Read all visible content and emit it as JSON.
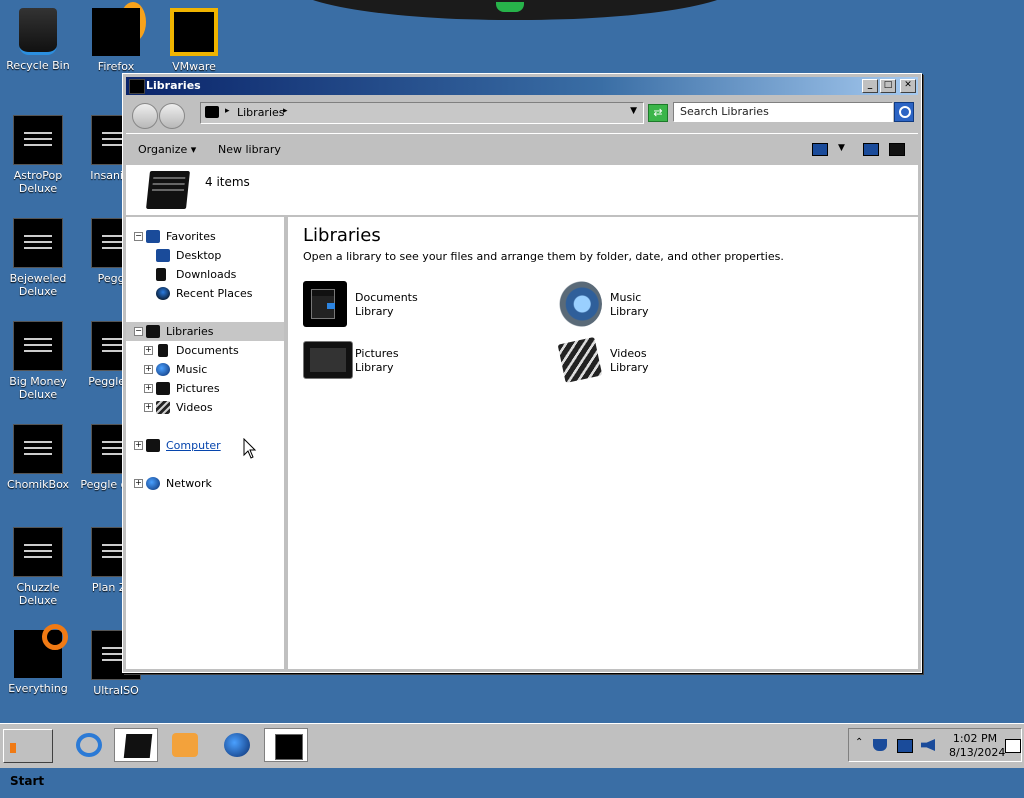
{
  "desktop": {
    "icons": [
      {
        "label": "Recycle Bin",
        "icon": "recycle-bin-icon"
      },
      {
        "label": "Firefox",
        "icon": "firefox-icon"
      },
      {
        "label": "VMware",
        "icon": "vmware-icon"
      },
      {
        "label": "AstroPop Deluxe",
        "icon": "app-icon"
      },
      {
        "label": "Insani De",
        "icon": "app-icon"
      },
      {
        "label": "Bejeweled Deluxe",
        "icon": "app-icon"
      },
      {
        "label": "Peggle",
        "icon": "app-icon"
      },
      {
        "label": "Big Money Deluxe",
        "icon": "app-icon"
      },
      {
        "label": "Peggle De",
        "icon": "app-icon"
      },
      {
        "label": "ChomikBox",
        "icon": "app-icon"
      },
      {
        "label": "Peggle of Wa",
        "icon": "app-icon"
      },
      {
        "label": "Chuzzle Deluxe",
        "icon": "app-icon"
      },
      {
        "label": "Plan Zon",
        "icon": "app-icon"
      },
      {
        "label": "Everything",
        "icon": "everything-icon"
      },
      {
        "label": "UltraISO",
        "icon": "app-icon"
      }
    ]
  },
  "window": {
    "title": "Libraries",
    "address": {
      "crumb": "Libraries"
    },
    "search": {
      "placeholder": "Search Libraries"
    },
    "toolbar": {
      "organize": "Organize",
      "new_library": "New library"
    },
    "info": {
      "count": "4 items"
    },
    "nav": {
      "favorites": "Favorites",
      "desktop": "Desktop",
      "downloads": "Downloads",
      "recent": "Recent Places",
      "libraries": "Libraries",
      "documents": "Documents",
      "music": "Music",
      "pictures": "Pictures",
      "videos": "Videos",
      "computer": "Computer",
      "network": "Network"
    },
    "content": {
      "title": "Libraries",
      "subtitle": "Open a library to see your files and arrange them by folder, date, and other properties.",
      "libraries": [
        {
          "name": "Documents",
          "type": "Library",
          "icon": "documents-library-icon"
        },
        {
          "name": "Music",
          "type": "Library",
          "icon": "music-library-icon"
        },
        {
          "name": "Pictures",
          "type": "Library",
          "icon": "pictures-library-icon"
        },
        {
          "name": "Videos",
          "type": "Library",
          "icon": "videos-library-icon"
        }
      ]
    }
  },
  "taskbar": {
    "start": "Start",
    "clock": {
      "time": "1:02 PM",
      "date": "8/13/2024"
    }
  },
  "colors": {
    "desktop": "#3a6ea5",
    "titlebar": "#0a246a",
    "link": "#0645ad"
  }
}
